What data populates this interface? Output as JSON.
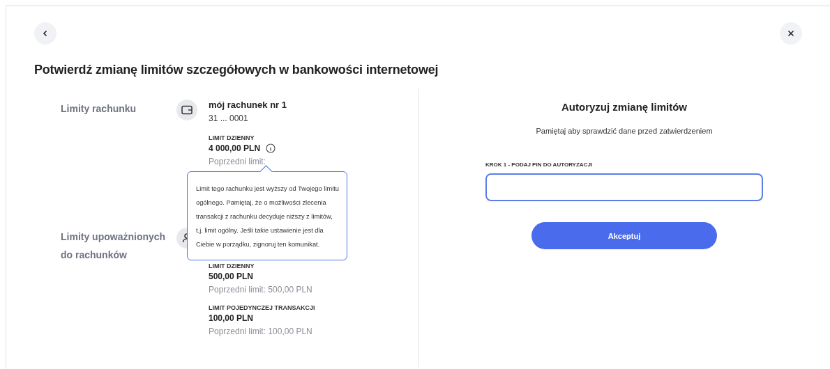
{
  "title": "Potwierdź zmianę limitów szczegółowych w bankowości internetowej",
  "sections": [
    {
      "label": "Limity rachunku",
      "kind": "account",
      "account": {
        "name": "mój rachunek nr 1",
        "number": "31 ... 0001"
      },
      "limits": [
        {
          "name": "LIMIT DZIENNY",
          "amount": "4 000,00 PLN",
          "info": true,
          "previous": "Poprzedni limit:"
        }
      ]
    },
    {
      "label": "Limity upoważnionych do rachunków",
      "kind": "authorized",
      "limits": [
        {
          "name": "LIMIT DZIENNY",
          "amount": "500,00 PLN",
          "info": false,
          "previous": "Poprzedni limit: 500,00 PLN"
        },
        {
          "name": "LIMIT POJEDYNCZEJ TRANSAKCJI",
          "amount": "100,00 PLN",
          "info": false,
          "previous": "Poprzedni limit: 100,00 PLN"
        }
      ]
    }
  ],
  "tooltip": "Limit tego rachunku jest wyższy od Twojego limitu ogólnego. Pamiętaj, że o możliwości zlecenia transakcji z rachunku decyduje niższy z limitów, t.j. limit ogólny. Jeśli takie ustawienie jest dla Ciebie w porządku, zignoruj ten komunikat.",
  "auth": {
    "title": "Autoryzuj zmianę limitów",
    "subtitle": "Pamiętaj aby sprawdzić dane przed zatwierdzeniem",
    "field_label": "KROK 1 - PODAJ PIN DO AUTORYZACJI",
    "button": "Akceptuj"
  }
}
